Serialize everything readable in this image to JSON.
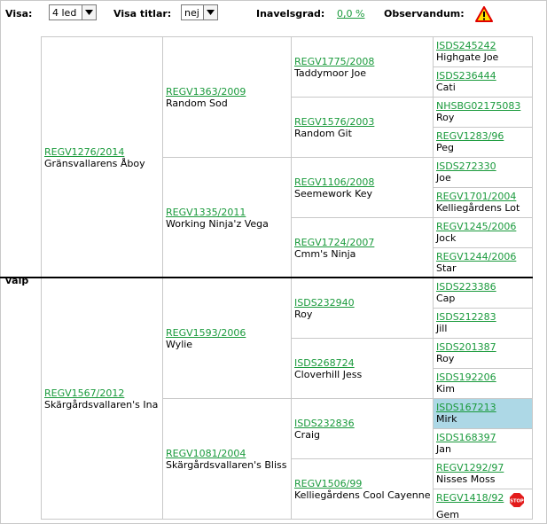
{
  "toolbar": {
    "visa_label": "Visa:",
    "visa_value": "4 led",
    "titlar_label": "Visa titlar:",
    "titlar_value": "nej",
    "inavel_label": "Inavelsgrad:",
    "inavel_value": "0,0 %",
    "observandum_label": "Observandum:"
  },
  "subject": "valp",
  "gen1": [
    {
      "reg": "REGV1276/2014",
      "name": "Gränsvallarens Åboy"
    },
    {
      "reg": "REGV1567/2012",
      "name": "Skärgårdsvallaren's Ina"
    }
  ],
  "gen2": [
    {
      "reg": "REGV1363/2009",
      "name": "Random Sod"
    },
    {
      "reg": "REGV1335/2011",
      "name": "Working Ninja'z Vega"
    },
    {
      "reg": "REGV1593/2006",
      "name": "Wylie"
    },
    {
      "reg": "REGV1081/2004",
      "name": "Skärgårdsvallaren's Bliss"
    }
  ],
  "gen3": [
    {
      "reg": "REGV1775/2008",
      "name": "Taddymoor Joe"
    },
    {
      "reg": "REGV1576/2003",
      "name": "Random Git"
    },
    {
      "reg": "REGV1106/2008",
      "name": "Seemework Key"
    },
    {
      "reg": "REGV1724/2007",
      "name": "Cmm's Ninja"
    },
    {
      "reg": "ISDS232940",
      "name": "Roy"
    },
    {
      "reg": "ISDS268724",
      "name": "Cloverhill Jess"
    },
    {
      "reg": "ISDS232836",
      "name": "Craig"
    },
    {
      "reg": "REGV1506/99",
      "name": "Kelliegårdens Cool Cayenne"
    }
  ],
  "gen4": [
    {
      "reg": "ISDS245242",
      "name": "Highgate Joe"
    },
    {
      "reg": "ISDS236444",
      "name": "Cati"
    },
    {
      "reg": "NHSBG02175083",
      "name": "Roy"
    },
    {
      "reg": "REGV1283/96",
      "name": "Peg"
    },
    {
      "reg": "ISDS272330",
      "name": "Joe"
    },
    {
      "reg": "REGV1701/2004",
      "name": "Kelliegårdens Lot"
    },
    {
      "reg": "REGV1245/2006",
      "name": "Jock"
    },
    {
      "reg": "REGV1244/2006",
      "name": "Star"
    },
    {
      "reg": "ISDS223386",
      "name": "Cap"
    },
    {
      "reg": "ISDS212283",
      "name": "Jill"
    },
    {
      "reg": "ISDS201387",
      "name": "Roy"
    },
    {
      "reg": "ISDS192206",
      "name": "Kim"
    },
    {
      "reg": "ISDS167213",
      "name": "Mirk",
      "highlight": true
    },
    {
      "reg": "ISDS168397",
      "name": "Jan"
    },
    {
      "reg": "REGV1292/97",
      "name": "Nisses Moss"
    },
    {
      "reg": "REGV1418/92",
      "name": "Gem",
      "stop": true
    }
  ],
  "icons": {
    "observandum": "warning-triangle-icon",
    "stop": "stop-sign-icon"
  },
  "colors": {
    "link": "#1a9a3c",
    "highlight": "#add8e6",
    "warning": "#e00000"
  }
}
